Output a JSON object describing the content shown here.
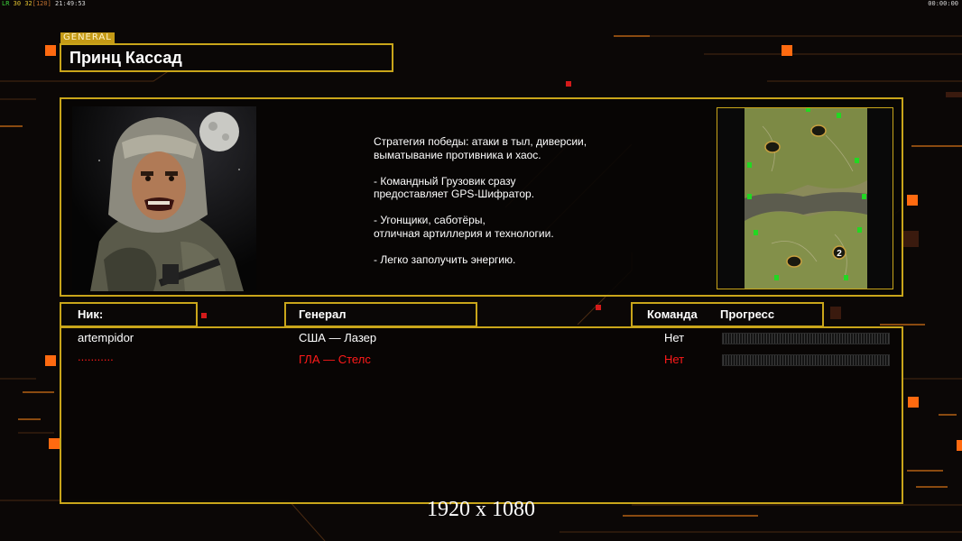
{
  "hud": {
    "left_label": "LR",
    "fps": "30",
    "target_fps": "32",
    "max_fps": "[120]",
    "clock": "21:49:53",
    "timer": "00:00:00"
  },
  "general": {
    "tag": "GENERAL",
    "name": "Принц Кассад",
    "description": "Стратегия победы: атаки в тыл, диверсии,\n выматывание противника и хаос.\n\n- Командный Грузовик сразу\nпредоставляет GPS-Шифратор.\n\n- Угонщики, саботёры,\nотличная артиллерия и технологии.\n\n- Легко заполучить энергию."
  },
  "minimap": {
    "start_position_label": "2"
  },
  "table": {
    "headers": {
      "nick": "Ник:",
      "general": "Генерал",
      "team": "Команда",
      "progress": "Прогресс"
    },
    "rows": [
      {
        "nick": "artempidor",
        "general": "США — Лазер",
        "team": "Нет",
        "progress": 0,
        "color": "#ffffff"
      },
      {
        "nick": "...........",
        "general": "ГЛА — Стелс",
        "team": "Нет",
        "progress": 0,
        "color": "#ff1a1a"
      }
    ]
  },
  "footer": {
    "resolution": "1920 x 1080"
  },
  "colors": {
    "frame": "#c9a51a",
    "accent_orange": "#ff6a10",
    "player_red": "#ff1a1a"
  }
}
